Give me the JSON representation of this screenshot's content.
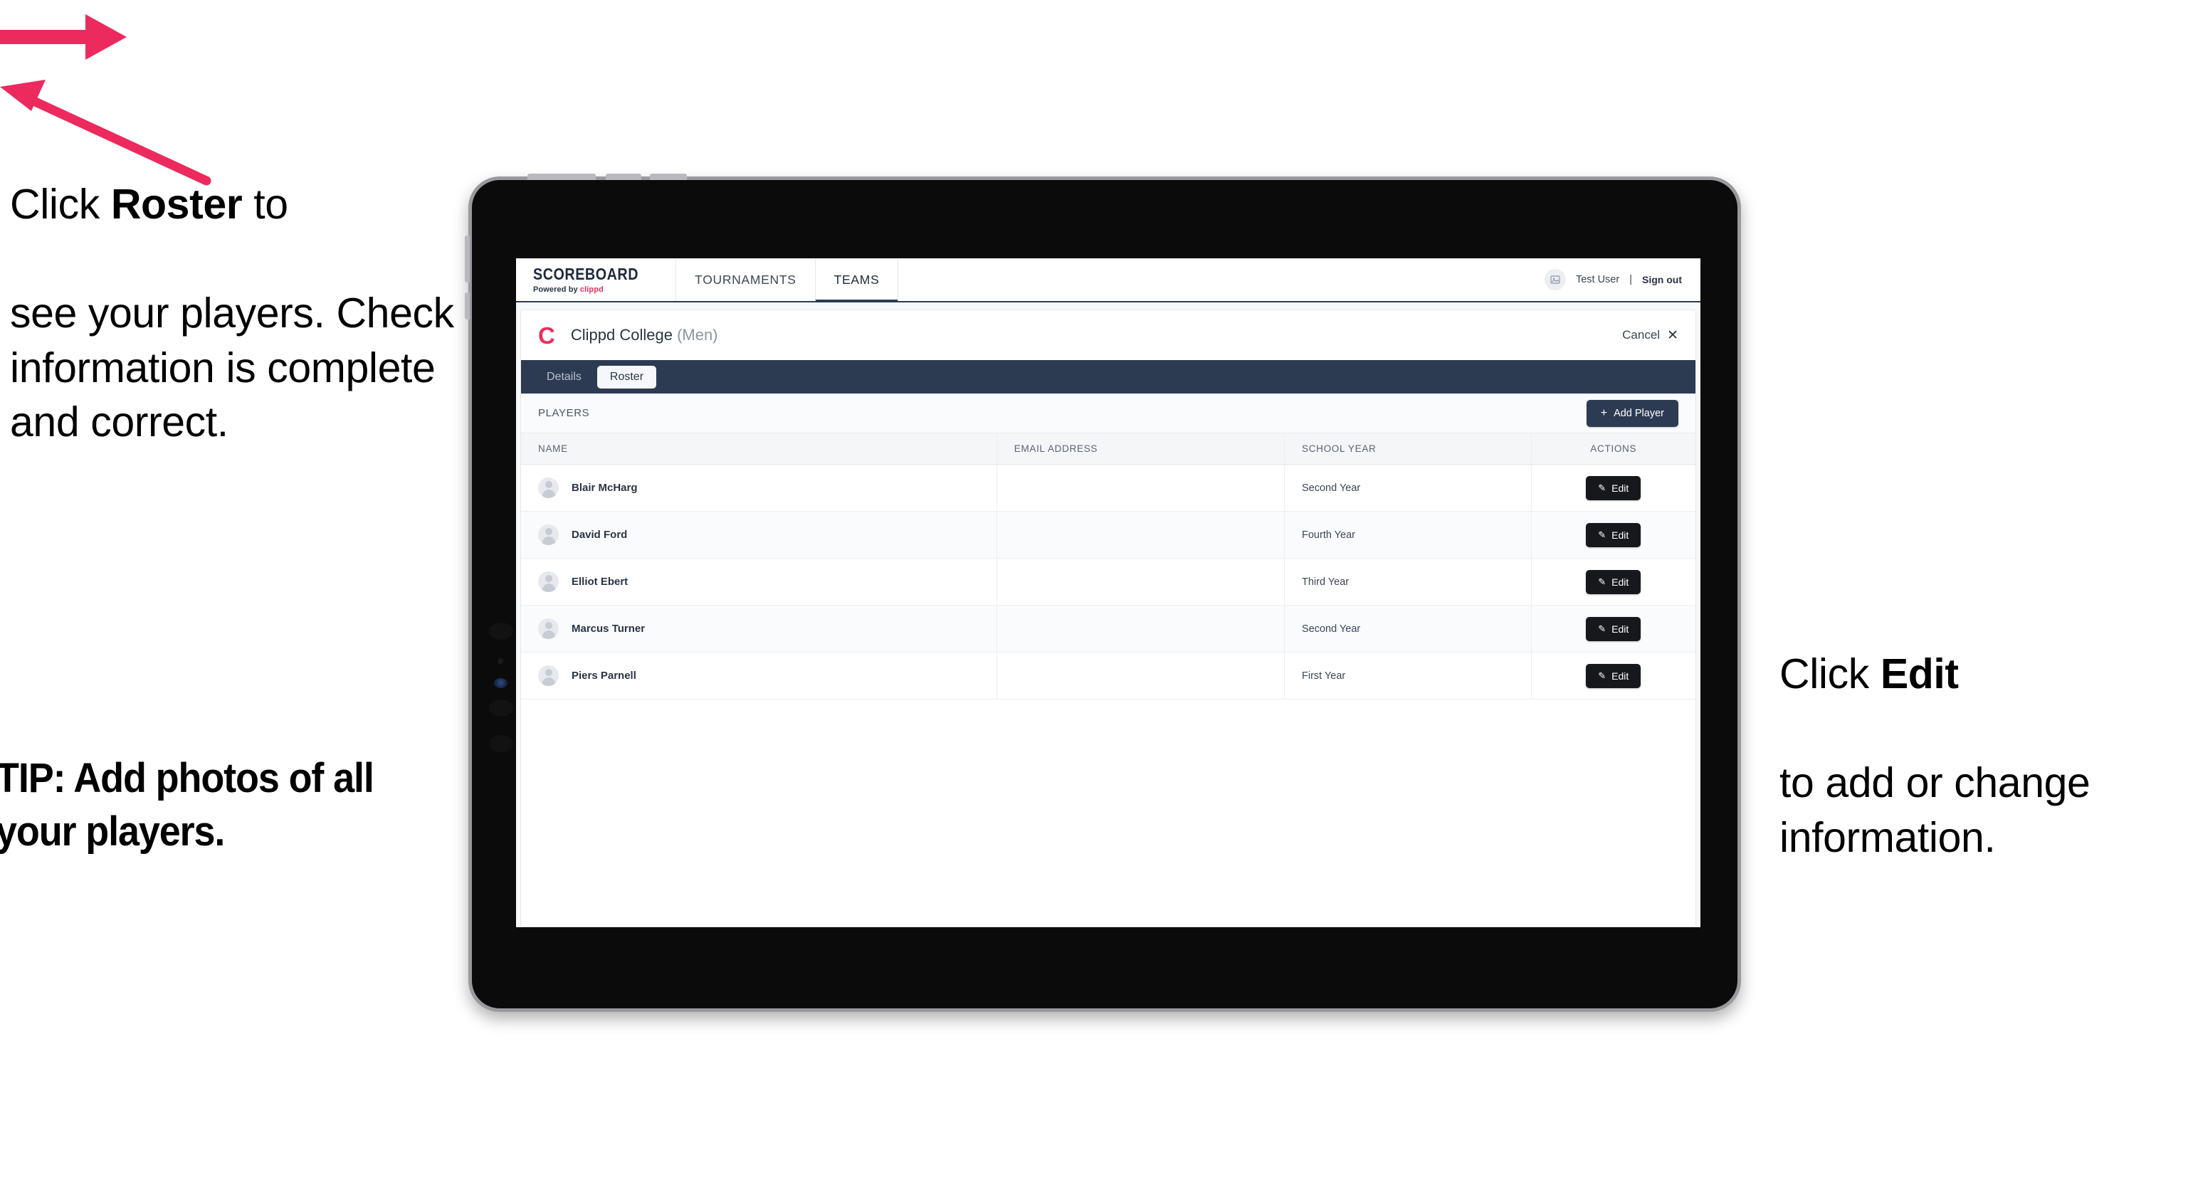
{
  "annotations": {
    "left": {
      "line1_pre": "Click ",
      "line1_bold": "Roster",
      "line1_post": " to",
      "rest": "see your players. Check information is complete and correct."
    },
    "tip": "TIP: Add photos of all your players.",
    "right": {
      "line1_pre": "Click ",
      "line1_bold": "Edit",
      "rest": "to add or change information."
    }
  },
  "app": {
    "brand": {
      "name": "SCOREBOARD",
      "powered_prefix": "Powered by ",
      "powered_brand": "clippd"
    },
    "nav": [
      {
        "label": "TOURNAMENTS",
        "active": false
      },
      {
        "label": "TEAMS",
        "active": true
      }
    ],
    "user": {
      "avatar_icon": "user-avatar-icon",
      "name": "Test User",
      "separator": "|",
      "sign_out": "Sign out"
    },
    "team": {
      "logo_letter": "C",
      "name": "Clippd College",
      "gender": "(Men)",
      "cancel_label": "Cancel",
      "cancel_icon": "close-icon"
    },
    "tabs": [
      {
        "label": "Details",
        "active": false
      },
      {
        "label": "Roster",
        "active": true
      }
    ],
    "players_section": {
      "title": "PLAYERS",
      "add_button": {
        "icon": "plus-icon",
        "label": "Add Player"
      }
    },
    "table": {
      "columns": [
        "NAME",
        "EMAIL ADDRESS",
        "SCHOOL YEAR",
        "ACTIONS"
      ],
      "rows": [
        {
          "name": "Blair McHarg",
          "email": "",
          "school_year": "Second Year",
          "action": "Edit"
        },
        {
          "name": "David Ford",
          "email": "",
          "school_year": "Fourth Year",
          "action": "Edit"
        },
        {
          "name": "Elliot Ebert",
          "email": "",
          "school_year": "Third Year",
          "action": "Edit"
        },
        {
          "name": "Marcus Turner",
          "email": "",
          "school_year": "Second Year",
          "action": "Edit"
        },
        {
          "name": "Piers Parnell",
          "email": "",
          "school_year": "First Year",
          "action": "Edit"
        }
      ]
    }
  },
  "colors": {
    "accent_pink": "#ec2f5d",
    "navy": "#2c3b52",
    "dark_button": "#17181c",
    "arrow": "#ec2a5e"
  }
}
